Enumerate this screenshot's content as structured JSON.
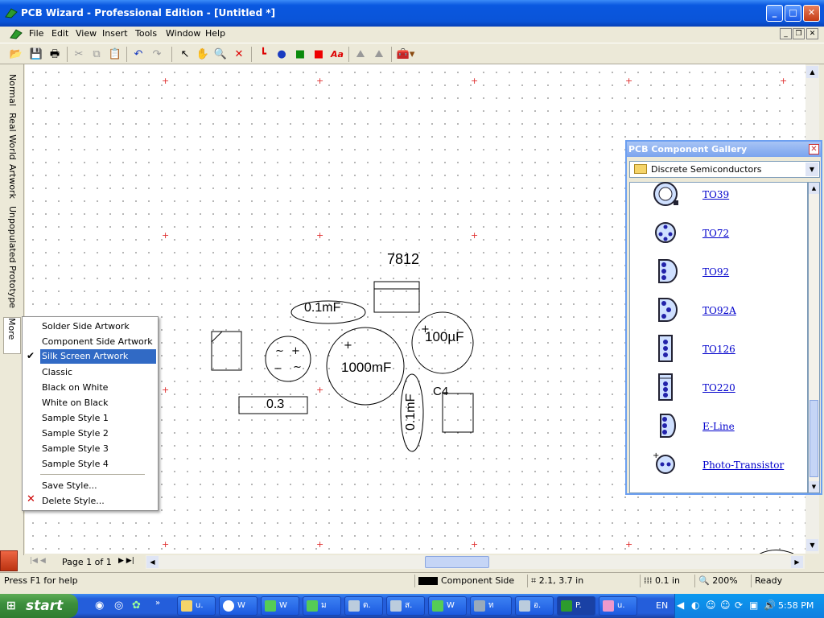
{
  "window": {
    "title": "PCB Wizard - Professional Edition - [Untitled *]"
  },
  "menu": {
    "items": [
      "File",
      "Edit",
      "View",
      "Insert",
      "Tools",
      "Window",
      "Help"
    ]
  },
  "toolbar": {
    "icons": [
      "open-icon",
      "save-icon",
      "print-icon",
      "cut-icon",
      "copy-icon",
      "paste-icon",
      "undo-icon",
      "redo-icon",
      "select-icon",
      "pan-icon",
      "zoom-icon",
      "delete-icon",
      "track-icon",
      "pad-icon",
      "shape-icon",
      "rectangle-icon",
      "text-icon",
      "rotate-icon",
      "flip-icon",
      "component-icon"
    ]
  },
  "view_tabs": [
    "Normal",
    "Real World",
    "Artwork",
    "Unpopulated",
    "Prototype",
    "More"
  ],
  "context_menu": {
    "items": [
      "Solder Side Artwork",
      "Component Side Artwork",
      "Silk Screen Artwork",
      "Classic",
      "Black on White",
      "White on Black",
      "Sample Style 1",
      "Sample Style 2",
      "Sample Style 3",
      "Sample Style 4"
    ],
    "checked": "Silk Screen Artwork",
    "save_label": "Save Style...",
    "delete_label": "Delete Style..."
  },
  "board": {
    "labels": {
      "reg": "7812",
      "cap_small_top": "0.1mF",
      "cap_big": "1000mF",
      "cap_med": "100µF",
      "resistor": "0.3",
      "cap_vert": "0.1mF",
      "c4": "C4"
    }
  },
  "gallery": {
    "title": "PCB Component Gallery",
    "category": "Discrete Semiconductors",
    "items": [
      "TO39",
      "TO72",
      "TO92",
      "TO92A",
      "TO126",
      "TO220",
      "E-Line",
      "Photo-Transistor"
    ]
  },
  "page_nav": {
    "label": "Page 1 of 1"
  },
  "status": {
    "help": "Press F1 for help",
    "side": "Component Side",
    "coords": "2.1, 3.7 in",
    "grid": "0.1 in",
    "zoom": "200%",
    "state": "Ready"
  },
  "taskbar": {
    "start": "start",
    "tasks": [
      "u.",
      "W",
      "W",
      "ม",
      "ด.",
      "ส.",
      "W",
      "ท",
      "อ.",
      "P.",
      "u."
    ],
    "lang": "EN",
    "clock": "5:58 PM"
  },
  "colors": {
    "titlebar": "#0a54d8",
    "selection": "#316ac5",
    "link": "#0000cc",
    "grid_cross": "#e03030"
  }
}
